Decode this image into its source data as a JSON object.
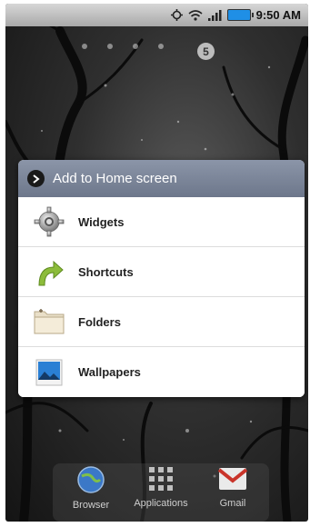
{
  "status_bar": {
    "time": "9:50 AM"
  },
  "home": {
    "page_number": "5"
  },
  "dialog": {
    "title": "Add to Home screen",
    "items": [
      {
        "label": "Widgets",
        "icon": "gear-icon"
      },
      {
        "label": "Shortcuts",
        "icon": "arrow-icon"
      },
      {
        "label": "Folders",
        "icon": "folder-icon"
      },
      {
        "label": "Wallpapers",
        "icon": "picture-icon"
      }
    ]
  },
  "dock": {
    "items": [
      {
        "label": "Browser",
        "icon": "globe-icon"
      },
      {
        "label": "Applications",
        "icon": "grid-icon"
      },
      {
        "label": "Gmail",
        "icon": "gmail-icon"
      }
    ]
  }
}
